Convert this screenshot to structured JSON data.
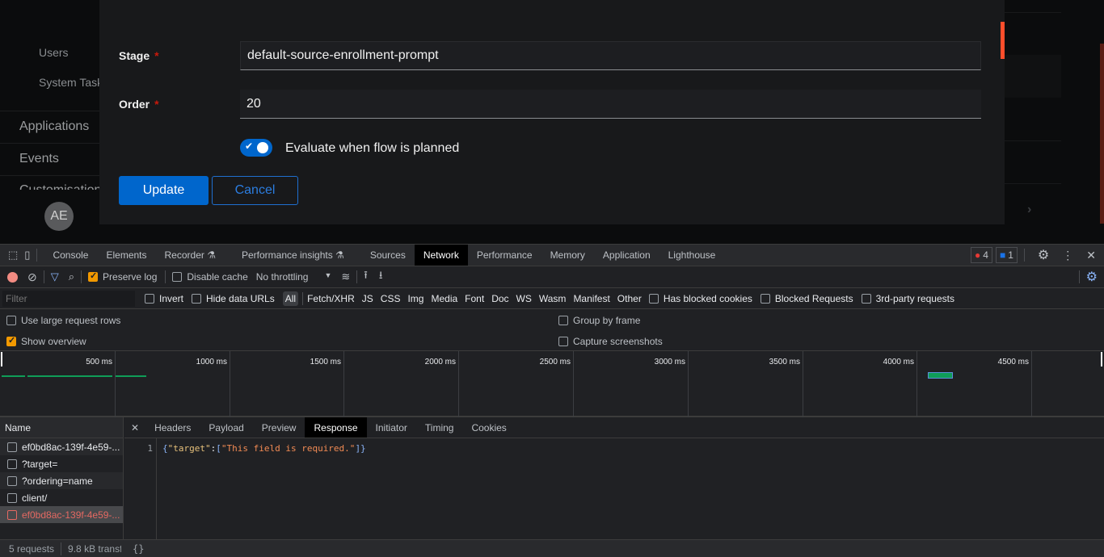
{
  "app": {
    "sidebar": {
      "sub_items": [
        "Users",
        "System Tasks"
      ],
      "main_items": [
        "Applications",
        "Events",
        "Customisation"
      ],
      "avatar": "AE"
    },
    "form": {
      "stage_label": "Stage",
      "stage_value": "default-source-enrollment-prompt",
      "order_label": "Order",
      "order_value": "20",
      "required_mark": "*",
      "toggle_label": "Evaluate when flow is planned",
      "toggle_on": true,
      "update_label": "Update",
      "cancel_label": "Cancel"
    },
    "colors": {
      "primary": "#0066cc",
      "scroll_accent": "#ff4e2b",
      "required": "#c9190b"
    }
  },
  "devtools": {
    "tabs": [
      "Console",
      "Elements",
      "Recorder",
      "Performance insights",
      "Sources",
      "Network",
      "Performance",
      "Memory",
      "Application",
      "Lighthouse"
    ],
    "active_tab": "Network",
    "error_count": "4",
    "message_count": "1",
    "toolbar": {
      "preserve_log": "Preserve log",
      "disable_cache": "Disable cache",
      "throttling": "No throttling"
    },
    "filter": {
      "placeholder": "Filter",
      "invert": "Invert",
      "hide_data_urls": "Hide data URLs",
      "types": [
        "All",
        "Fetch/XHR",
        "JS",
        "CSS",
        "Img",
        "Media",
        "Font",
        "Doc",
        "WS",
        "Wasm",
        "Manifest",
        "Other"
      ],
      "has_blocked_cookies": "Has blocked cookies",
      "blocked_requests": "Blocked Requests",
      "third_party": "3rd-party requests"
    },
    "options": {
      "large_rows": "Use large request rows",
      "show_overview": "Show overview",
      "group_by_frame": "Group by frame",
      "capture_screenshots": "Capture screenshots"
    },
    "timeline": {
      "ticks": [
        "500 ms",
        "1000 ms",
        "1500 ms",
        "2000 ms",
        "2500 ms",
        "3000 ms",
        "3500 ms",
        "4000 ms",
        "4500 ms"
      ]
    },
    "requests": {
      "header": "Name",
      "items": [
        {
          "name": "ef0bd8ac-139f-4e59-...",
          "error": false
        },
        {
          "name": "?target=",
          "error": false
        },
        {
          "name": "?ordering=name",
          "error": false
        },
        {
          "name": "client/",
          "error": false
        },
        {
          "name": "ef0bd8ac-139f-4e59-...",
          "error": true
        }
      ]
    },
    "detail_tabs": [
      "Headers",
      "Payload",
      "Preview",
      "Response",
      "Initiator",
      "Timing",
      "Cookies"
    ],
    "active_detail": "Response",
    "response": {
      "line_number": "1",
      "key": "\"target\"",
      "value": "\"This field is required.\""
    },
    "status": {
      "requests": "5 requests",
      "transferred": "9.8 kB transf",
      "pretty_print": "{}"
    }
  }
}
